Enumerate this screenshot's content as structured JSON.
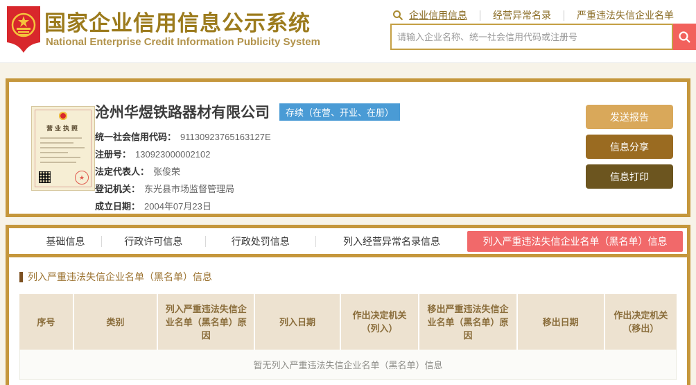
{
  "header": {
    "title": "国家企业信用信息公示系统",
    "subtitle": "National Enterprise Credit Information Publicity System",
    "nav_links": [
      {
        "label": "企业信用信息"
      },
      {
        "label": "经营异常名录"
      },
      {
        "label": "严重违法失信企业名单"
      }
    ],
    "search_placeholder": "请输入企业名称、统一社会信用代码或注册号"
  },
  "company": {
    "name": "沧州华煜铁路器材有限公司",
    "status": "存续（在营、开业、在册）",
    "license_title": "营业执照",
    "fields": [
      {
        "label": "统一社会信用代码：",
        "value": "91130923765163127E"
      },
      {
        "label": "注册号：",
        "value": "130923000002102"
      },
      {
        "label": "法定代表人：",
        "value": "张俊荣"
      },
      {
        "label": "登记机关：",
        "value": "东光县市场监督管理局"
      },
      {
        "label": "成立日期：",
        "value": "2004年07月23日"
      }
    ],
    "actions": [
      {
        "label": "发送报告"
      },
      {
        "label": "信息分享"
      },
      {
        "label": "信息打印"
      }
    ]
  },
  "tabs": [
    {
      "label": "基础信息",
      "active": false
    },
    {
      "label": "行政许可信息",
      "active": false
    },
    {
      "label": "行政处罚信息",
      "active": false
    },
    {
      "label": "列入经营异常名录信息",
      "active": false
    },
    {
      "label": "列入严重违法失信企业名单（黑名单）信息",
      "active": true
    }
  ],
  "blacklist_section": {
    "heading": "列入严重违法失信企业名单（黑名单）信息",
    "columns": [
      "序号",
      "类别",
      "列入严重违法失信企业名单（黑名单）原因",
      "列入日期",
      "作出决定机关（列入）",
      "移出严重违法失信企业名单（黑名单）原因",
      "移出日期",
      "作出决定机关（移出）"
    ],
    "empty_message": "暂无列入严重违法失信企业名单（黑名单）信息"
  },
  "colors": {
    "accent_gold_border": "#c5973c",
    "title_gold": "#9c7b1d",
    "subtitle_gold": "#b2934b",
    "nav_link_brown": "#8b6d26",
    "search_button_red": "#f2615c",
    "status_badge_blue": "#4a9bd5",
    "active_tab_red": "#f1696a",
    "button_send": "#d9a85a",
    "button_share": "#9a6b21",
    "button_print": "#6c551f",
    "table_header_bg": "#ede2d0",
    "table_header_text": "#8a6d3b"
  }
}
